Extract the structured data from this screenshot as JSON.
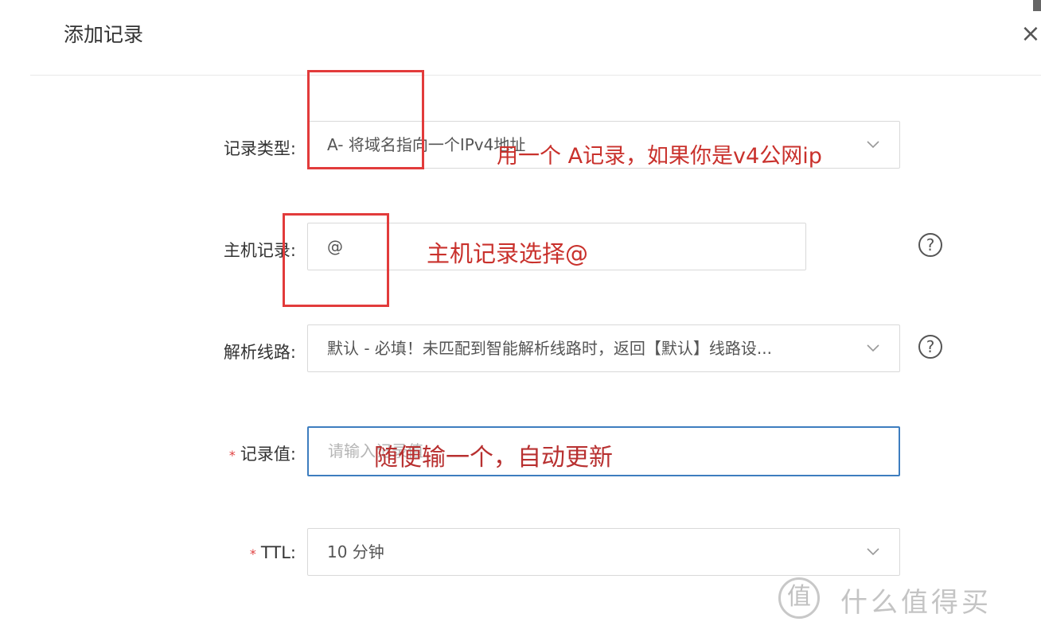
{
  "dialog": {
    "title": "添加记录",
    "close_glyph": "×"
  },
  "form": {
    "record_type": {
      "label": "记录类型",
      "colon": ":",
      "value": "A- 将域名指向一个IPv4地址"
    },
    "host_record": {
      "label": "主机记录",
      "colon": ":",
      "value": "@"
    },
    "line": {
      "label": "解析线路",
      "colon": ":",
      "value": "默认 - 必填！未匹配到智能解析线路时，返回【默认】线路设..."
    },
    "record_value": {
      "label": "记录值",
      "required_mark": "*",
      "colon": ":",
      "placeholder": "请输入记录值"
    },
    "ttl": {
      "label": "TTL",
      "required_mark": "*",
      "colon": ":",
      "value": "10 分钟"
    },
    "help_glyph": "?"
  },
  "annotations": {
    "record_type_note": "用一个 A记录，如果你是v4公网ip",
    "host_note": "主机记录选择@",
    "value_note": "随便输一个，自动更新"
  },
  "watermark": {
    "logo_glyph": "值",
    "text": "什么值得买"
  },
  "colors": {
    "annotation_red": "#c9312c",
    "highlight_box": "#e23b3b",
    "focus_border": "#3d7dbf"
  },
  "icons": [
    "close-icon",
    "chevron-down-icon",
    "help-circle-icon",
    "smzdm-logo-icon"
  ]
}
